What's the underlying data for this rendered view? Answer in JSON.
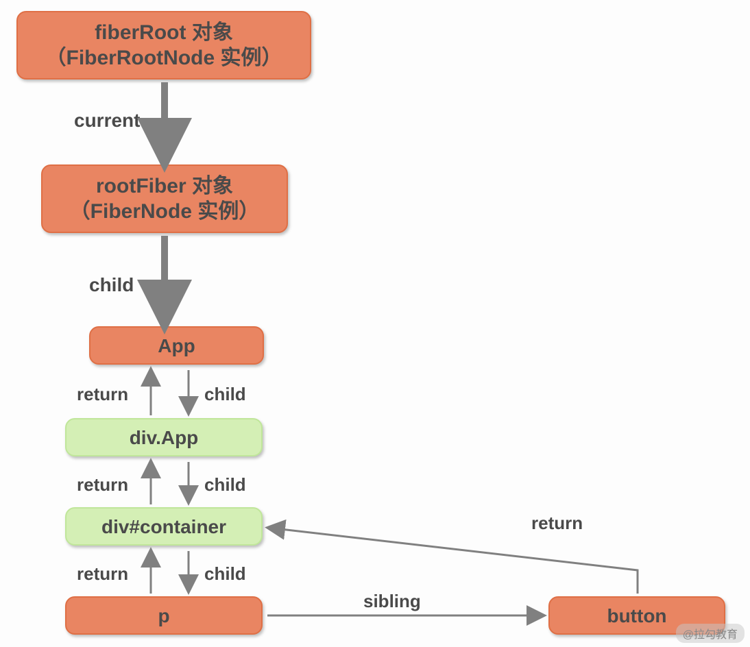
{
  "nodes": {
    "fiberRoot": {
      "line1": "fiberRoot 对象",
      "line2": "（FiberRootNode 实例）"
    },
    "rootFiber": {
      "line1": "rootFiber 对象",
      "line2": "（FiberNode 实例）"
    },
    "app": "App",
    "divApp": "div.App",
    "divContainer": "div#container",
    "p": "p",
    "button": "button"
  },
  "edges": {
    "current": "current",
    "child": "child",
    "return": "return",
    "sibling": "sibling"
  },
  "watermark": "@拉勾教育",
  "colors": {
    "orange": "#e98562",
    "green": "#d4efb5",
    "arrow": "#808080",
    "arrowThick": "#808080"
  }
}
